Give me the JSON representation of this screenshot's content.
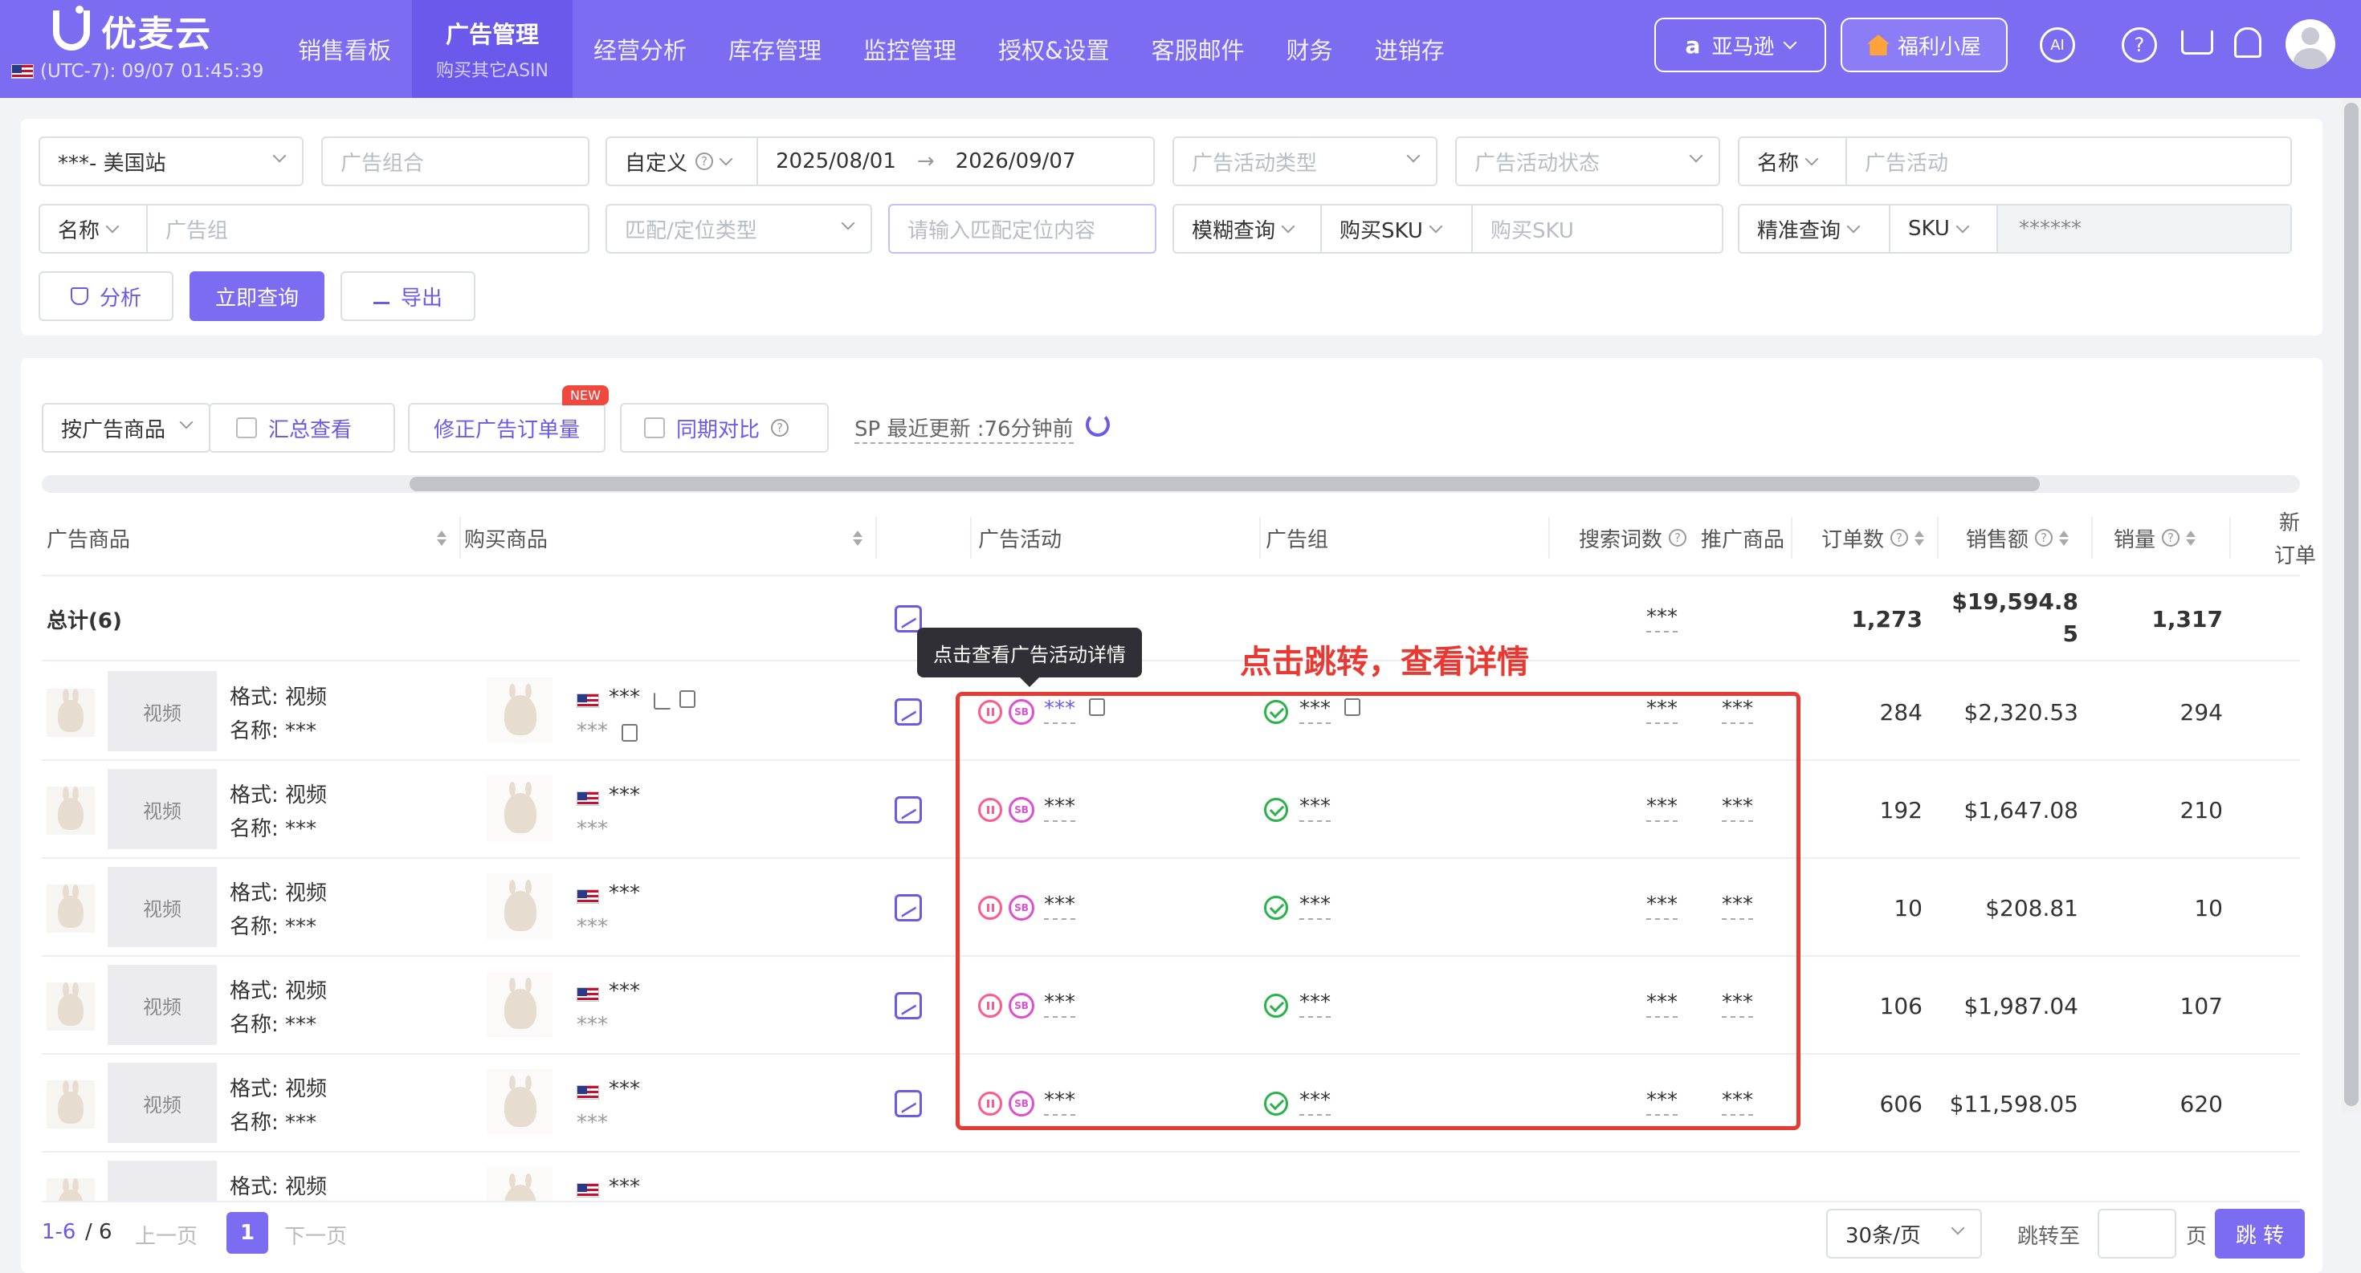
{
  "app": {
    "logo": "优麦云",
    "timezone": "(UTC-7): 09/07 01:45:39"
  },
  "nav": {
    "items": [
      "销售看板",
      "广告管理",
      "经营分析",
      "库存管理",
      "监控管理",
      "授权&设置",
      "客服邮件",
      "财务",
      "进销存"
    ],
    "active_sub": "购买其它ASIN",
    "marketplace": "亚马逊",
    "marketplace_mark": "a",
    "welfare": "福利小屋",
    "ai_label": "AI",
    "help_mark": "?"
  },
  "filters": {
    "site": "***- 美国站",
    "ad_portfolio_ph": "广告组合",
    "date_mode": "自定义",
    "date_start": "2025/08/01",
    "date_arrow": "→",
    "date_end": "2026/09/07",
    "campaign_type_ph": "广告活动类型",
    "campaign_status_ph": "广告活动状态",
    "campaign_field": "名称",
    "campaign_ph": "广告活动",
    "group_field": "名称",
    "group_ph": "广告组",
    "match_type_ph": "匹配/定位类型",
    "match_content_ph": "请输入匹配定位内容",
    "fuzzy": "模糊查询",
    "buy_sku": "购买SKU",
    "buy_sku_ph": "购买SKU",
    "exact": "精准查询",
    "sku": "SKU",
    "sku_value": "******",
    "btn_analyze": "分析",
    "btn_query": "立即查询",
    "btn_export": "导出"
  },
  "toolbar": {
    "group_by": "按广告商品",
    "summary": "汇总查看",
    "fix_orders": "修正广告订单量",
    "new_badge": "NEW",
    "yoy": "同期对比",
    "sp_update": "SP 最近更新 :76分钟前"
  },
  "table": {
    "headers": {
      "ad_product": "广告商品",
      "buy_product": "购买商品",
      "campaign": "广告活动",
      "ad_group": "广告组",
      "search_terms": "搜索词数",
      "promoted": "推广商品",
      "orders": "订单数",
      "sales": "销售额",
      "units": "销量",
      "new_orders_1": "新",
      "new_orders_2": "订单"
    },
    "total": {
      "label": "总计(6)",
      "search_terms": "***",
      "orders": "1,273",
      "sales_1": "$19,594.8",
      "sales_2": "5",
      "units": "1,317"
    },
    "rows": [
      {
        "format": "格式: 视频",
        "name": "名称: ***",
        "video": "视频",
        "buy": "***",
        "buy_sub": "***",
        "campaign": "***",
        "group": "***",
        "search_terms": "***",
        "promoted": "***",
        "orders": "284",
        "sales": "$2,320.53",
        "units": "294",
        "sb": "SB"
      },
      {
        "format": "格式: 视频",
        "name": "名称: ***",
        "video": "视频",
        "buy": "***",
        "buy_sub": "***",
        "campaign": "***",
        "group": "***",
        "search_terms": "***",
        "promoted": "***",
        "orders": "192",
        "sales": "$1,647.08",
        "units": "210",
        "sb": "SB"
      },
      {
        "format": "格式: 视频",
        "name": "名称: ***",
        "video": "视频",
        "buy": "***",
        "buy_sub": "***",
        "campaign": "***",
        "group": "***",
        "search_terms": "***",
        "promoted": "***",
        "orders": "10",
        "sales": "$208.81",
        "units": "10",
        "sb": "SB"
      },
      {
        "format": "格式: 视频",
        "name": "名称: ***",
        "video": "视频",
        "buy": "***",
        "buy_sub": "***",
        "campaign": "***",
        "group": "***",
        "search_terms": "***",
        "promoted": "***",
        "orders": "106",
        "sales": "$1,987.04",
        "units": "107",
        "sb": "SB"
      },
      {
        "format": "格式: 视频",
        "name": "名称: ***",
        "video": "视频",
        "buy": "***",
        "buy_sub": "***",
        "campaign": "***",
        "group": "***",
        "search_terms": "***",
        "promoted": "***",
        "orders": "606",
        "sales": "$11,598.05",
        "units": "620",
        "sb": "SB"
      },
      {
        "format": "格式: 视频",
        "buy": "***"
      }
    ]
  },
  "tooltip": "点击查看广告活动详情",
  "annotation": "点击跳转，查看详情",
  "pager": {
    "range": "1-6",
    "total": "/ 6",
    "prev": "上一页",
    "current": "1",
    "next": "下一页",
    "page_size": "30条/页",
    "jump_label": "跳转至",
    "page_unit": "页",
    "jump_btn": "跳 转"
  },
  "colors": {
    "accent": "#7b6cf2",
    "annotation": "#e83a33",
    "status_ok": "#29b34a",
    "paused": "#ff5a8a"
  }
}
